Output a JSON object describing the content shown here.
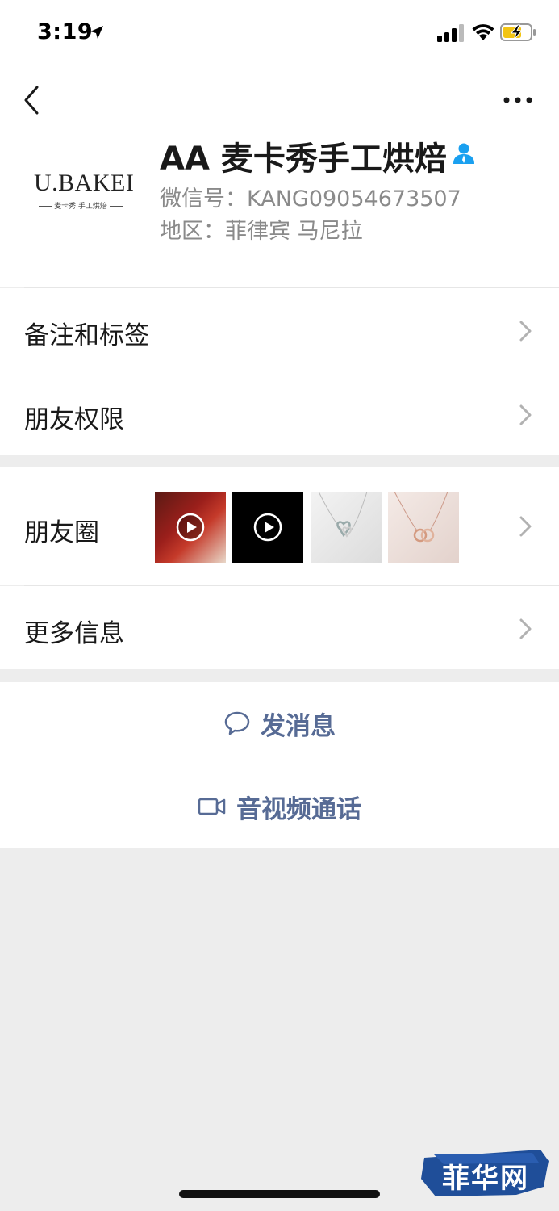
{
  "status_bar": {
    "time": "3:19"
  },
  "profile": {
    "avatar_brand": "U.BAKEI",
    "avatar_subtitle": "麦卡秀 手工烘焙",
    "name": "AA 麦卡秀手工烘焙",
    "wechat_id": "微信号：KANG09054673507",
    "region": "地区：菲律宾 马尼拉"
  },
  "rows": {
    "remarks_tags": "备注和标签",
    "friend_permissions": "朋友权限",
    "moments": "朋友圈",
    "more_info": "更多信息"
  },
  "actions": {
    "send_message": "发消息",
    "video_call": "音视频通话"
  },
  "watermark": "菲华网",
  "colors": {
    "link_blue": "#576b95",
    "background": "#ededed",
    "contact_icon": "#1aa0f0"
  }
}
